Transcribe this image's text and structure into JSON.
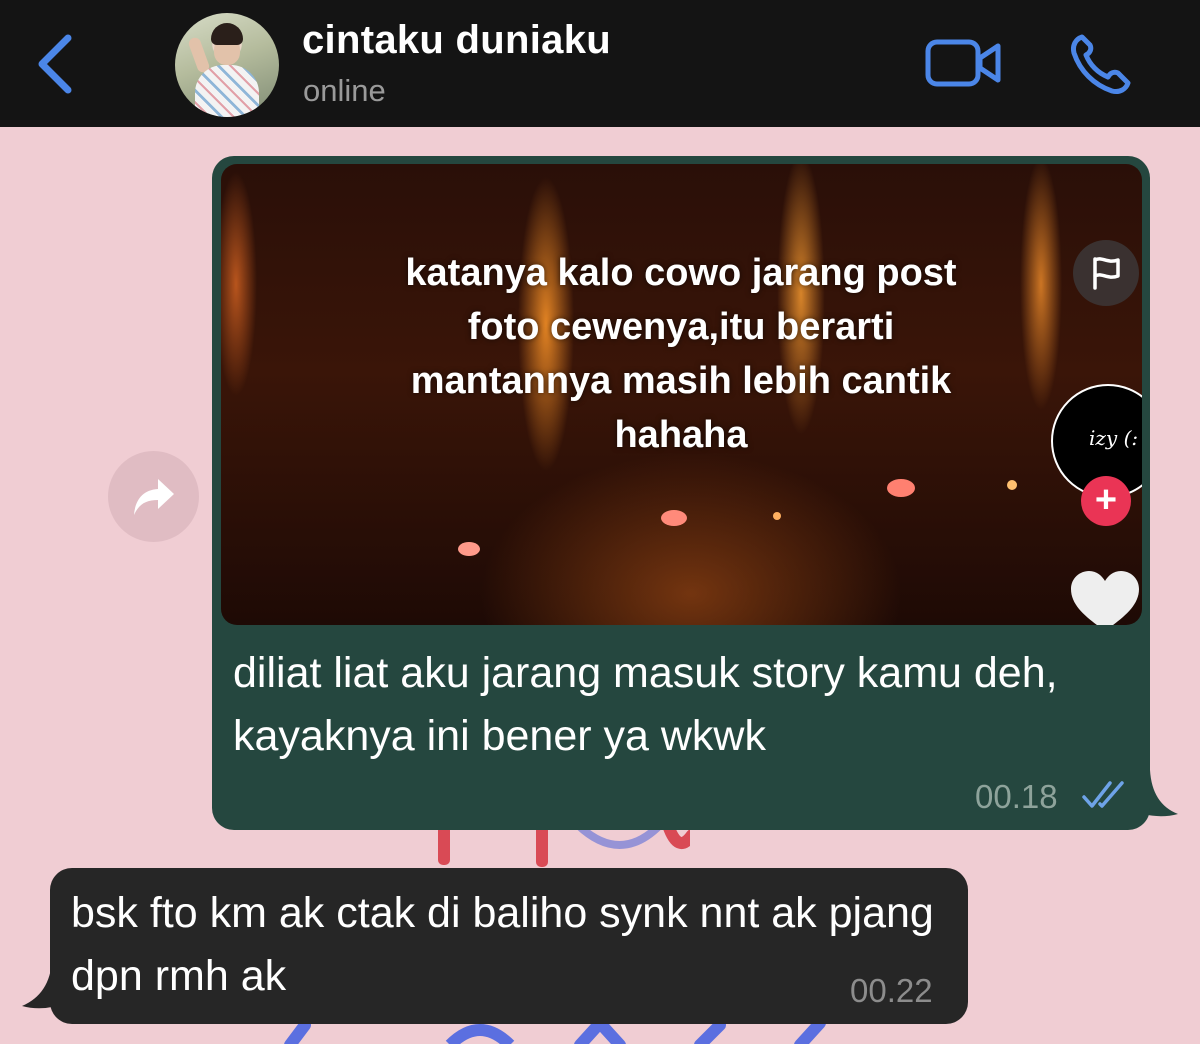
{
  "header": {
    "contact_name": "cintaku duniaku",
    "status": "online",
    "icons": {
      "back": "chevron-left-icon",
      "video": "video-camera-icon",
      "call": "phone-icon"
    }
  },
  "colors": {
    "header_bg": "#141414",
    "accent": "#4b86e8",
    "wallpaper": "#f0cdd3",
    "outgoing_bubble": "#25473f",
    "incoming_bubble": "#262626"
  },
  "messages": [
    {
      "direction": "outgoing",
      "media": {
        "type": "video",
        "caption": "katanya kalo cowo jarang post foto cewenya,itu berarti mantannya masih lebih cantik hahaha",
        "creator_label": "izy (:",
        "icons": [
          "flag-icon",
          "plus-icon",
          "heart-icon"
        ]
      },
      "text": "diliat liat aku jarang masuk story kamu deh, kayaknya ini bener ya wkwk",
      "time": "00.18",
      "status_icon": "double-check-icon"
    },
    {
      "direction": "incoming",
      "text": "bsk fto km ak ctak di baliho synk nnt ak pjang dpn rmh ak",
      "time": "00.22"
    }
  ]
}
